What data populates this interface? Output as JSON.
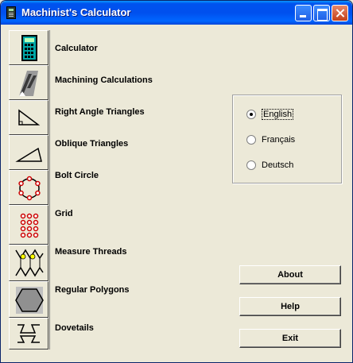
{
  "window": {
    "title": "Machinist's Calculator"
  },
  "tools": [
    {
      "label": "Calculator",
      "icon": "calculator-icon"
    },
    {
      "label": "Machining Calculations",
      "icon": "drill-bit-icon"
    },
    {
      "label": "Right Angle Triangles",
      "icon": "right-triangle-icon"
    },
    {
      "label": "Oblique Triangles",
      "icon": "oblique-triangle-icon"
    },
    {
      "label": "Bolt Circle",
      "icon": "bolt-circle-icon"
    },
    {
      "label": "Grid",
      "icon": "grid-icon"
    },
    {
      "label": "Measure Threads",
      "icon": "thread-icon"
    },
    {
      "label": "Regular Polygons",
      "icon": "hexagon-icon"
    },
    {
      "label": "Dovetails",
      "icon": "dovetail-icon"
    }
  ],
  "languages": {
    "options": [
      "English",
      "Français",
      "Deutsch"
    ],
    "selected": "English"
  },
  "buttons": {
    "about": "About",
    "help": "Help",
    "exit": "Exit"
  },
  "colors": {
    "title_bar": "#0054e3",
    "face": "#ece9d8",
    "accent_red": "#cc0000"
  }
}
